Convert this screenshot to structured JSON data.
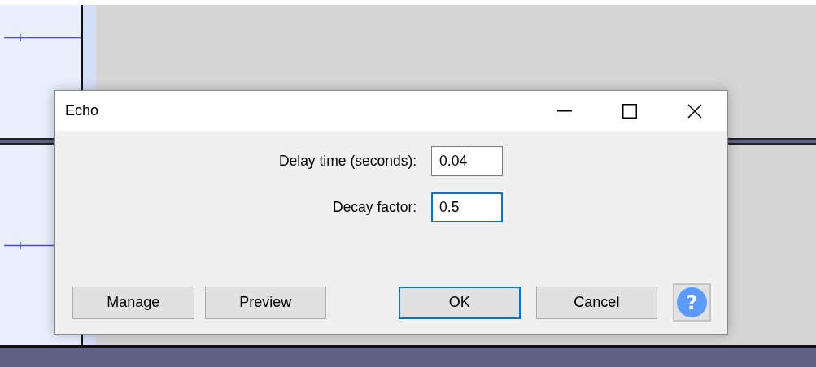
{
  "dialog": {
    "title": "Echo",
    "fields": [
      {
        "label": "Delay time (seconds):",
        "value": "0.04",
        "focused": false
      },
      {
        "label": "Decay factor:",
        "value": "0.5",
        "focused": true
      }
    ],
    "buttons": [
      {
        "label": "Manage",
        "default": false
      },
      {
        "label": "Preview",
        "default": false
      },
      {
        "label": "OK",
        "default": true
      },
      {
        "label": "Cancel",
        "default": false
      }
    ],
    "help_button": {
      "label": "?"
    }
  }
}
